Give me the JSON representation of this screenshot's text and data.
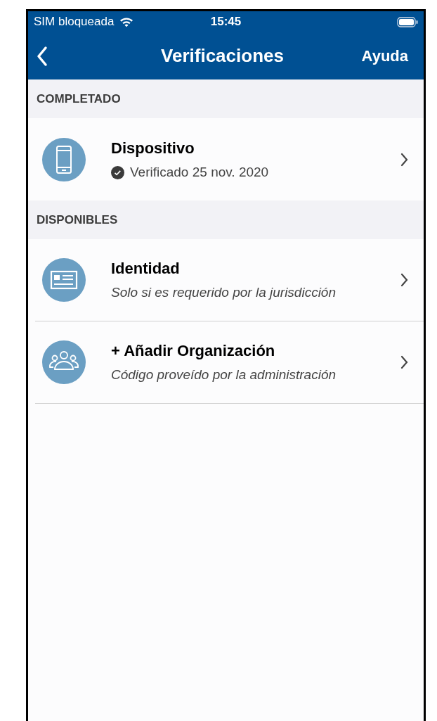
{
  "status_bar": {
    "carrier": "SIM bloqueada",
    "time": "15:45"
  },
  "nav_bar": {
    "title": "Verificaciones",
    "action": "Ayuda"
  },
  "sections": [
    {
      "header": "COMPLETADO",
      "items": [
        {
          "kind": "device",
          "title": "Dispositivo",
          "subtitle": "Verificado 25 nov. 2020",
          "verified": true
        }
      ]
    },
    {
      "header": "DISPONIBLES",
      "items": [
        {
          "kind": "identity",
          "title": "Identidad",
          "subtitle": "Solo si es requerido por la jurisdicción",
          "verified": false
        },
        {
          "kind": "organization",
          "title": "+ Añadir Organización",
          "subtitle": "Código proveído por la administración",
          "verified": false
        }
      ]
    }
  ]
}
